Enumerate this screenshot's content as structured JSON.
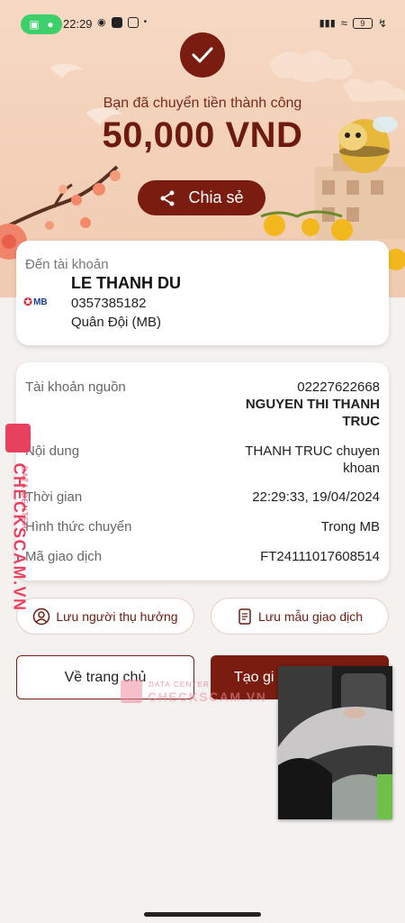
{
  "status_bar": {
    "time": "22:29",
    "battery": "9"
  },
  "success": {
    "message": "Bạn đã chuyển tiền thành công",
    "amount": "50,000 VND",
    "share_label": "Chia sẻ"
  },
  "recipient": {
    "label": "Đến tài khoản",
    "bank_logo": "MB",
    "name": "LE THANH DU",
    "account_number": "0357385182",
    "bank_name": "Quân Đội (MB)"
  },
  "details": {
    "source_label": "Tài khoản nguồn",
    "source_account": "02227622668",
    "source_name_line1": "NGUYEN THI THANH",
    "source_name_line2": "TRUC",
    "content_label": "Nội dung",
    "content_line1": "THANH TRUC chuyen",
    "content_line2": "khoan",
    "time_label": "Thời gian",
    "time_value": "22:29:33, 19/04/2024",
    "method_label": "Hình thức chuyển",
    "method_value": "Trong MB",
    "txn_label": "Mã giao dịch",
    "txn_value": "FT24111017608514"
  },
  "actions": {
    "save_beneficiary": "Lưu người thụ hưởng",
    "save_template": "Lưu mẫu giao dịch",
    "home": "Về trang chủ",
    "new_transaction": "Tạo gi"
  },
  "watermark": {
    "brand": "CHECKSCAM.VN",
    "subtitle": "DATA CENTER"
  }
}
